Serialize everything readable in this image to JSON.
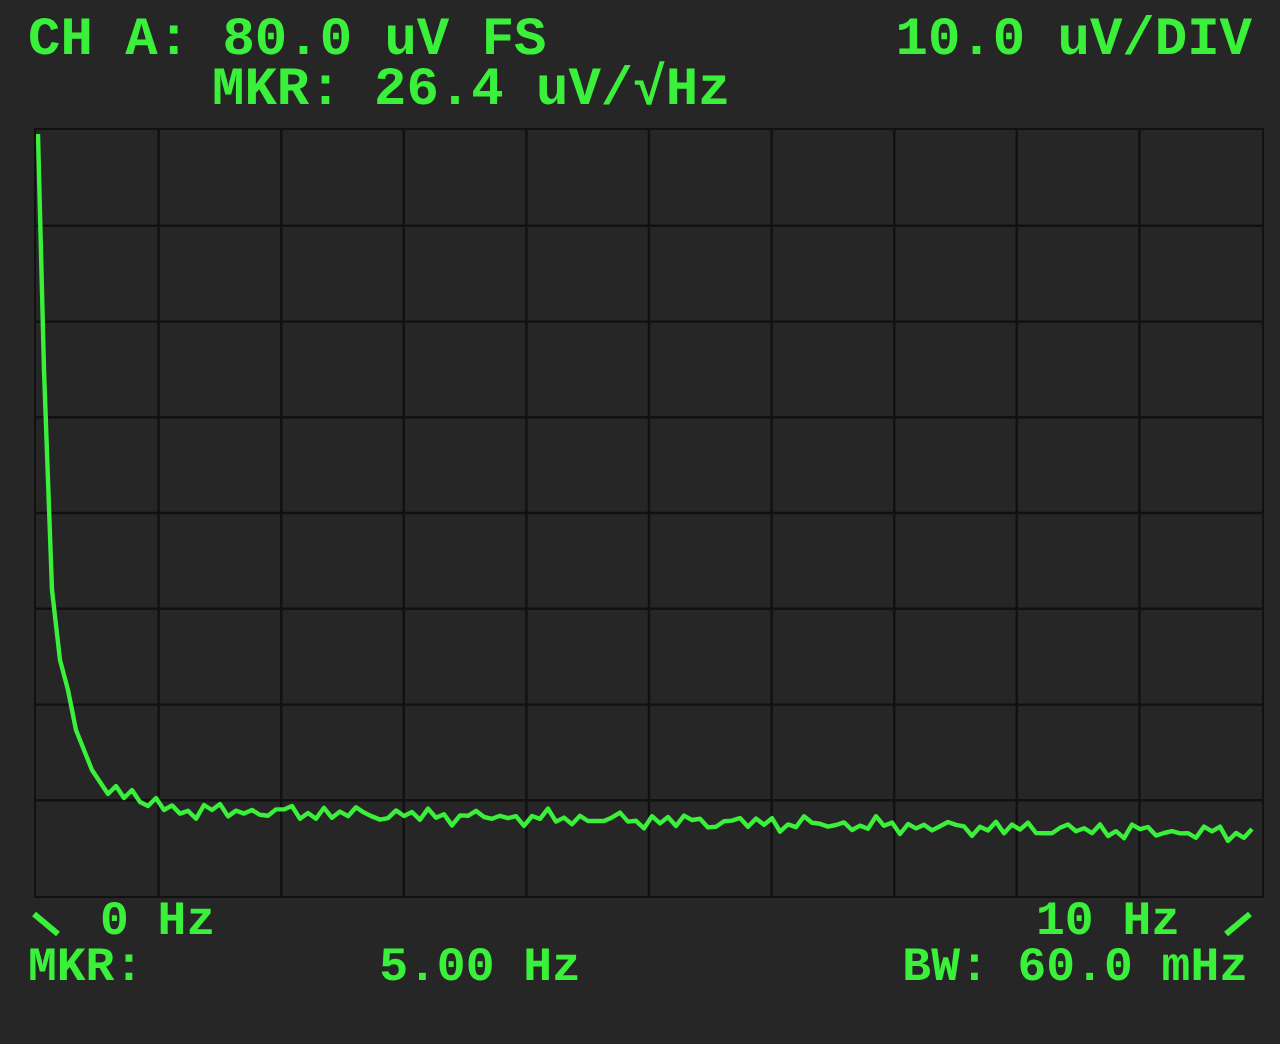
{
  "header": {
    "channel_scale": "CH A: 80.0 uV FS",
    "division_scale": "10.0 uV/DIV",
    "marker_reading": "MKR: 26.4 uV/√Hz"
  },
  "footer": {
    "start_frequency": "0 Hz",
    "stop_frequency": "10 Hz",
    "marker_label": "MKR:",
    "marker_frequency": "5.00 Hz",
    "bandwidth": "BW: 60.0 mHz"
  }
}
